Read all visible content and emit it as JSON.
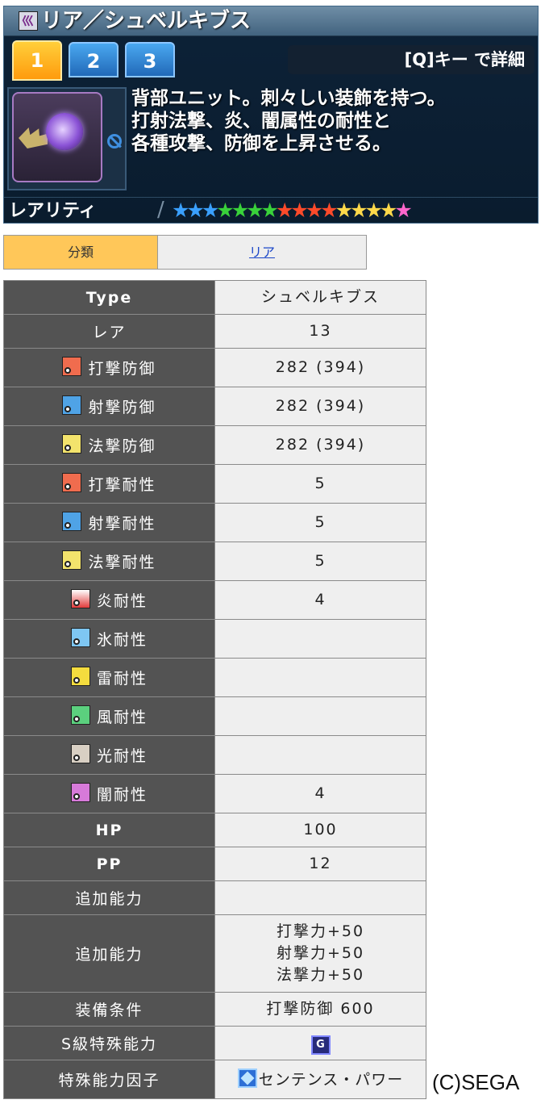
{
  "panel": {
    "title": "リア／シュベルキブス",
    "tabs": [
      {
        "label": "1",
        "active": true
      },
      {
        "label": "2",
        "active": false
      },
      {
        "label": "3",
        "active": false
      }
    ],
    "detail_hint": "[Q]キー で詳細",
    "description": [
      "背部ユニット。刺々しい装飾を持つ。",
      "打射法撃、炎、闇属性の耐性と",
      "各種攻撃、防御を上昇させる。"
    ],
    "rarity_label": "レアリティ",
    "rarity_slash": "/",
    "rarity": 13,
    "rarity_star_colors": [
      "#3aa0ff",
      "#3aa0ff",
      "#3aa0ff",
      "#39d13a",
      "#39d13a",
      "#39d13a",
      "#39d13a",
      "#ff4a2a",
      "#ff4a2a",
      "#ff4a2a",
      "#ff4a2a",
      "#ffd94a",
      "#ffd94a",
      "#ffd94a",
      "#ffd94a",
      "#ff66cc"
    ]
  },
  "category": {
    "label": "分類",
    "value": "リア"
  },
  "stats": [
    {
      "key": "Type",
      "value": "シュベルキブス",
      "icon": "",
      "bold": true,
      "h": 42
    },
    {
      "key": "レア",
      "value": "13",
      "icon": "",
      "h": 42
    },
    {
      "key": "打撃防御",
      "value": "282 (394)",
      "icon": "strike-defense-icon",
      "cls": "ic-strike",
      "h": 48
    },
    {
      "key": "射撃防御",
      "value": "282 (394)",
      "icon": "range-defense-icon",
      "cls": "ic-range",
      "h": 48
    },
    {
      "key": "法撃防御",
      "value": "282 (394)",
      "icon": "tech-defense-icon",
      "cls": "ic-tech",
      "h": 48
    },
    {
      "key": "打撃耐性",
      "value": "5",
      "icon": "strike-resist-icon",
      "cls": "ic-strike",
      "h": 48
    },
    {
      "key": "射撃耐性",
      "value": "5",
      "icon": "range-resist-icon",
      "cls": "ic-range",
      "h": 48
    },
    {
      "key": "法撃耐性",
      "value": "5",
      "icon": "tech-resist-icon",
      "cls": "ic-tech",
      "h": 48
    },
    {
      "key": "炎耐性",
      "value": "4",
      "icon": "fire-resist-icon",
      "cls": "ic-fire",
      "h": 48
    },
    {
      "key": "氷耐性",
      "value": "",
      "icon": "ice-resist-icon",
      "cls": "ic-ice",
      "h": 48
    },
    {
      "key": "雷耐性",
      "value": "",
      "icon": "thunder-resist-icon",
      "cls": "ic-thunder",
      "h": 48
    },
    {
      "key": "風耐性",
      "value": "",
      "icon": "wind-resist-icon",
      "cls": "ic-wind",
      "h": 48
    },
    {
      "key": "光耐性",
      "value": "",
      "icon": "light-resist-icon",
      "cls": "ic-light",
      "h": 48
    },
    {
      "key": "闇耐性",
      "value": "4",
      "icon": "dark-resist-icon",
      "cls": "ic-dark",
      "h": 48
    },
    {
      "key": "HP",
      "value": "100",
      "icon": "",
      "bold": true,
      "h": 42
    },
    {
      "key": "PP",
      "value": "12",
      "icon": "",
      "bold": true,
      "h": 42
    },
    {
      "key": "追加能力",
      "value": "",
      "icon": "",
      "h": 42
    },
    {
      "key": "追加能力",
      "value": "打撃力+50\n射撃力+50\n法撃力+50",
      "icon": "",
      "h": 96
    },
    {
      "key": "装備条件",
      "value": "打撃防御 600",
      "icon": "",
      "h": 42
    },
    {
      "key": "S級特殊能力",
      "value": "",
      "icon": "",
      "badge": "S-class-badge-icon",
      "h": 42
    },
    {
      "key": "特殊能力因子",
      "value": "センテンス・パワー",
      "icon": "",
      "factor": "factor-icon",
      "h": 48
    }
  ],
  "sclass_badge": "G",
  "copyright": "(C)SEGA"
}
